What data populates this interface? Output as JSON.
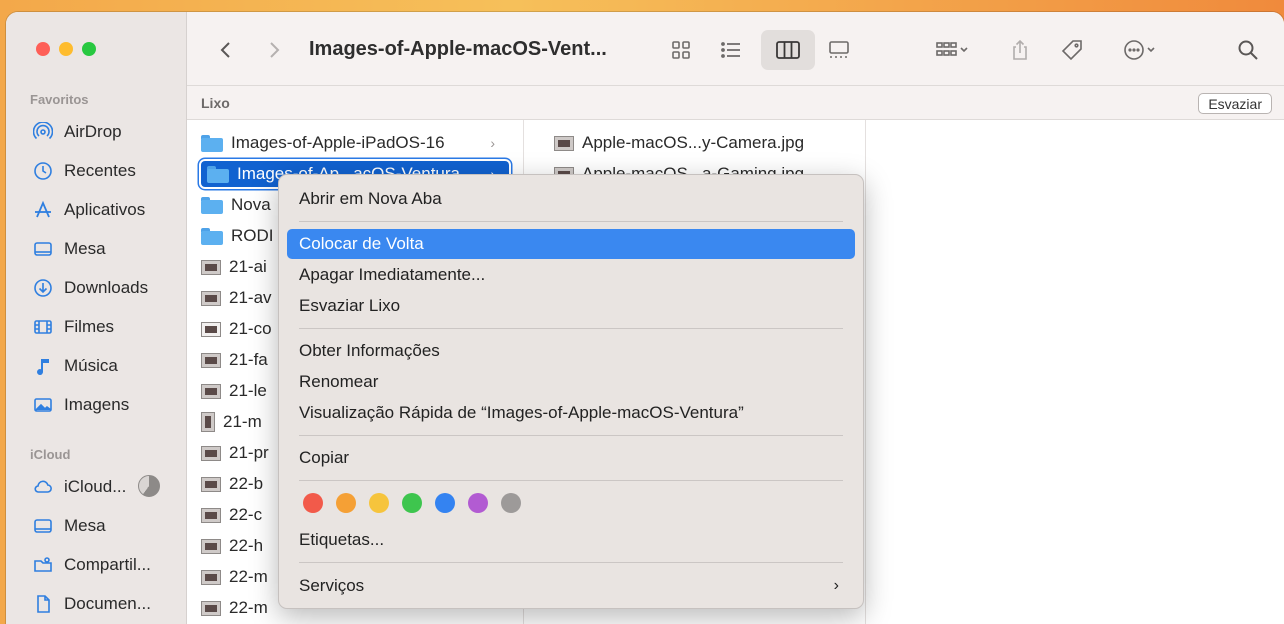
{
  "toolbar": {
    "title": "Images-of-Apple-macOS-Vent..."
  },
  "pathbar": {
    "location": "Lixo",
    "empty_button": "Esvaziar"
  },
  "sidebar": {
    "sections": [
      {
        "title": "Favoritos"
      },
      {
        "title": "iCloud"
      }
    ],
    "favorites": [
      {
        "label": "AirDrop",
        "icon": "airdrop-icon"
      },
      {
        "label": "Recentes",
        "icon": "clock-icon"
      },
      {
        "label": "Aplicativos",
        "icon": "applications-icon"
      },
      {
        "label": "Mesa",
        "icon": "desktop-icon"
      },
      {
        "label": "Downloads",
        "icon": "download-icon"
      },
      {
        "label": "Filmes",
        "icon": "film-icon"
      },
      {
        "label": "Música",
        "icon": "music-icon"
      },
      {
        "label": "Imagens",
        "icon": "photo-icon"
      }
    ],
    "icloud": [
      {
        "label": "iCloud...",
        "icon": "cloud-icon"
      },
      {
        "label": "Mesa",
        "icon": "desktop-icon"
      },
      {
        "label": "Compartil...",
        "icon": "shared-folder-icon"
      },
      {
        "label": "Documen...",
        "icon": "document-icon"
      }
    ]
  },
  "column1": {
    "items": [
      {
        "label": "Images-of-Apple-iPadOS-16",
        "type": "folder"
      },
      {
        "label": "Images-of-Ap...acOS-Ventura",
        "type": "folder"
      },
      {
        "label": "Nova",
        "type": "folder"
      },
      {
        "label": "RODI",
        "type": "folder"
      },
      {
        "label": "21-ai",
        "type": "image"
      },
      {
        "label": "21-av",
        "type": "image"
      },
      {
        "label": "21-co",
        "type": "image"
      },
      {
        "label": "21-fa",
        "type": "image"
      },
      {
        "label": "21-le",
        "type": "image"
      },
      {
        "label": "21-m",
        "type": "image"
      },
      {
        "label": "21-pr",
        "type": "image"
      },
      {
        "label": "22-b",
        "type": "image"
      },
      {
        "label": "22-c",
        "type": "image"
      },
      {
        "label": "22-h",
        "type": "image"
      },
      {
        "label": "22-m",
        "type": "image"
      },
      {
        "label": "22-m",
        "type": "image"
      }
    ]
  },
  "column2": {
    "items": [
      {
        "label": "Apple-macOS...y-Camera.jpg"
      },
      {
        "label": "Apple-macOS...a-Gaming.jpg"
      }
    ]
  },
  "context_menu": {
    "open_new_tab": "Abrir em Nova Aba",
    "put_back": "Colocar de Volta",
    "delete_immediately": "Apagar Imediatamente...",
    "empty_trash": "Esvaziar Lixo",
    "get_info": "Obter Informações",
    "rename": "Renomear",
    "quick_look": "Visualização Rápida de “Images-of-Apple-macOS-Ventura”",
    "copy": "Copiar",
    "tags_label": "Etiquetas...",
    "services": "Serviços",
    "tag_colors": [
      "#f25a4a",
      "#f5a035",
      "#f6c43c",
      "#3ec54e",
      "#3483f1",
      "#b25bd2",
      "#9d9a99"
    ],
    "highlight_color": "#3a88f0"
  }
}
